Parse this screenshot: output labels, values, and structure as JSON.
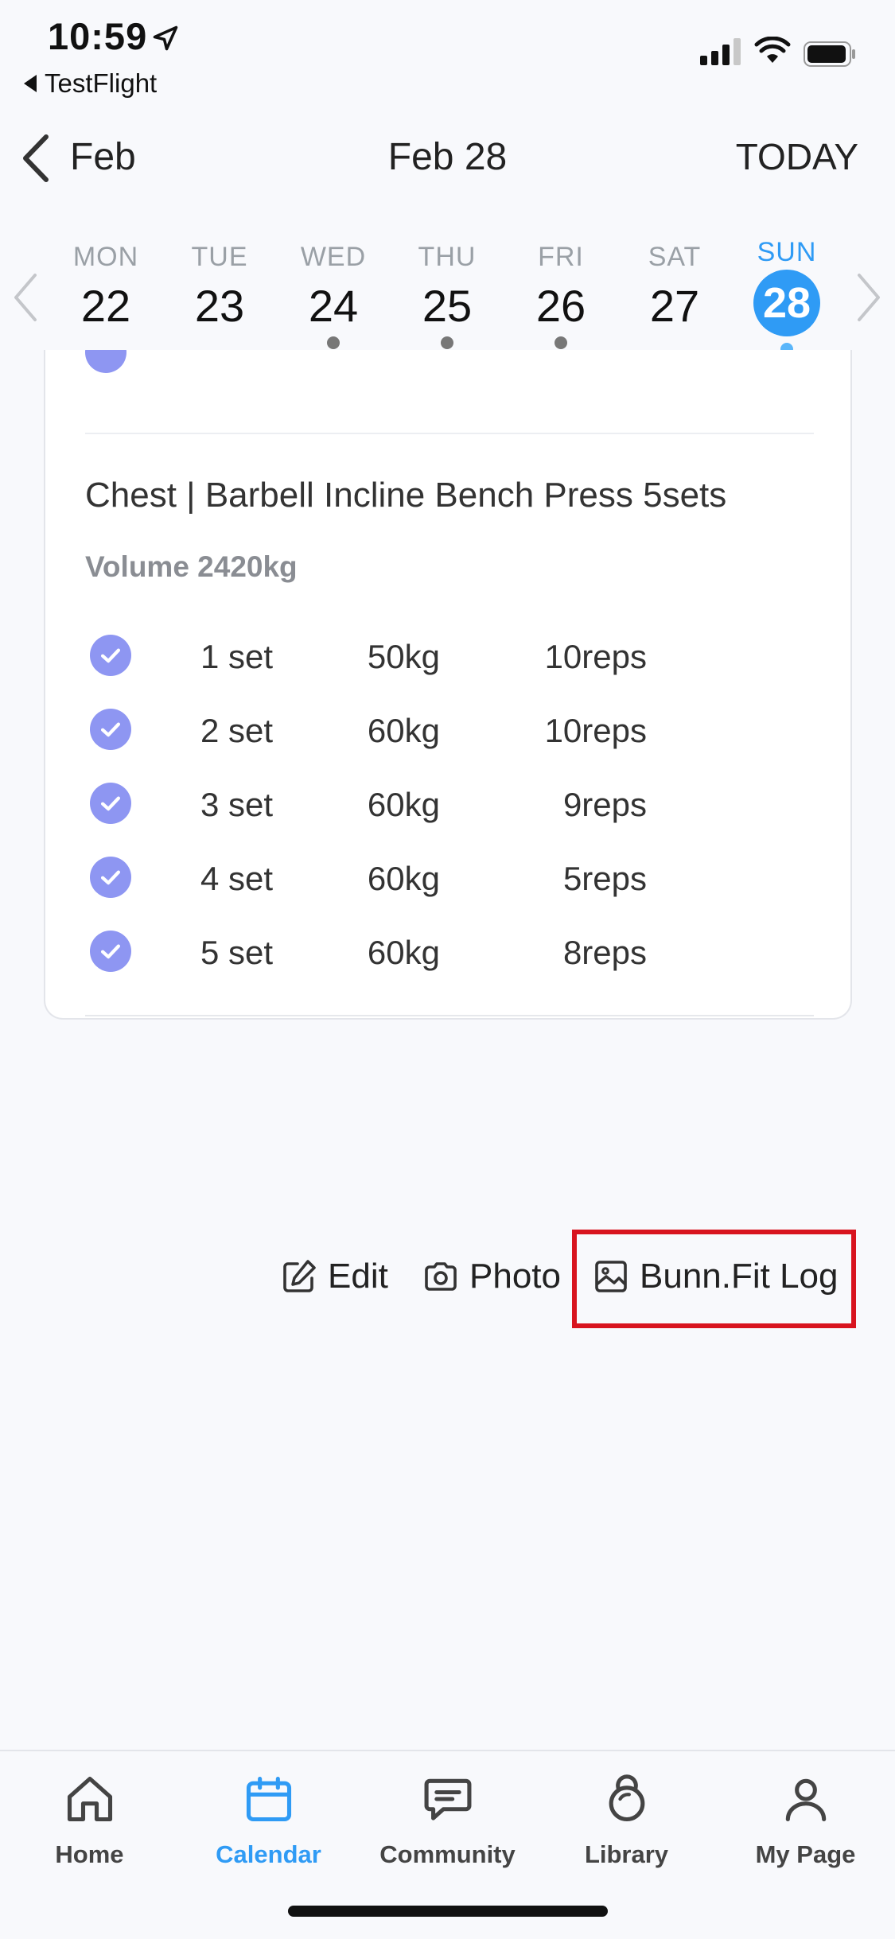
{
  "status": {
    "time": "10:59",
    "back_app": "TestFlight"
  },
  "nav": {
    "back_label": "Feb",
    "title": "Feb 28",
    "today_label": "TODAY"
  },
  "week": {
    "days": [
      {
        "name": "MON",
        "num": "22",
        "has_dot": false
      },
      {
        "name": "TUE",
        "num": "23",
        "has_dot": false
      },
      {
        "name": "WED",
        "num": "24",
        "has_dot": true
      },
      {
        "name": "THU",
        "num": "25",
        "has_dot": true
      },
      {
        "name": "FRI",
        "num": "26",
        "has_dot": true
      },
      {
        "name": "SAT",
        "num": "27",
        "has_dot": false
      },
      {
        "name": "SUN",
        "num": "28",
        "has_dot": true,
        "selected": true
      }
    ]
  },
  "card": {
    "exercise_title": "Chest | Barbell Incline Bench Press 5sets",
    "volume": "Volume 2420kg",
    "sets": [
      {
        "set": "1 set",
        "weight": "50kg",
        "reps": "10reps",
        "done": true
      },
      {
        "set": "2 set",
        "weight": "60kg",
        "reps": "10reps",
        "done": true
      },
      {
        "set": "3 set",
        "weight": "60kg",
        "reps": "9reps",
        "done": true
      },
      {
        "set": "4 set",
        "weight": "60kg",
        "reps": "5reps",
        "done": true
      },
      {
        "set": "5 set",
        "weight": "60kg",
        "reps": "8reps",
        "done": true
      }
    ]
  },
  "actions": {
    "edit": "Edit",
    "photo": "Photo",
    "log": "Bunn.Fit Log"
  },
  "tabs": [
    {
      "label": "Home",
      "icon": "home-icon"
    },
    {
      "label": "Calendar",
      "icon": "calendar-icon",
      "active": true
    },
    {
      "label": "Community",
      "icon": "chat-icon"
    },
    {
      "label": "Library",
      "icon": "kettlebell-icon"
    },
    {
      "label": "My Page",
      "icon": "person-icon"
    }
  ],
  "colors": {
    "accent": "#2f9bf5",
    "check": "#8e96f2",
    "highlight": "#d8141f",
    "background": "#f8f9fc"
  }
}
